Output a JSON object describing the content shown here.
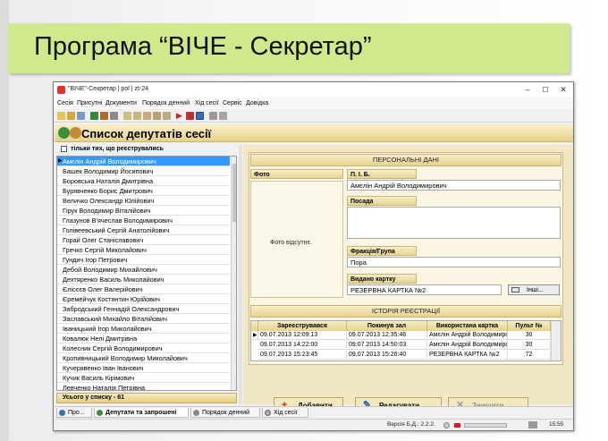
{
  "slide": {
    "title": "Програма “ВІЧЕ - Секретар”"
  },
  "window": {
    "title": "\"ВІЧЕ\"-Секретар | pol | zt-24",
    "controls": {
      "minimize": "–",
      "maximize": "☐",
      "close": "✕"
    }
  },
  "menu": [
    "Сесія",
    "Присутні",
    "Документи",
    "Порядок денний",
    "Хід сесії",
    "Сервіс",
    "Довідка"
  ],
  "header": {
    "title": "Список депутатів сесії"
  },
  "filter": {
    "label": "тільки тих, що реєструвались",
    "checked": false
  },
  "deputies": {
    "items": [
      "Амєлін Андрій Володимирович",
      "Башек Володимир Йосипович",
      "Боровська Наталія Дмитрівна",
      "Бурявченко Борис Дмитрович",
      "Величко Олександр Юлійович",
      "Гірук Володимир Віталійович",
      "Глазунов В'ячеслав Володимирович",
      "Голівеевський Сергій Анатолійович",
      "Горай Олег Станіславович",
      "Гречко Сергій Миколайович",
      "Гундич Ігор Петрович",
      "Дебой Володимир Михайлович",
      "Дехтяренко Василь Миколайович",
      "Єлісєєв Олег Валерійович",
      "Єремейчук Костянтин Юрійович",
      "Забродський Геннадій Олександрович",
      "Заславський Михайло Віталійович",
      "Іваницький Ігор Миколайович",
      "Ковалюк Нелі Дмитрівна",
      "Колесник Сергій Володимирович",
      "Кропивницький Володимир Миколайович",
      "Кучерявенко Іван Іванович",
      "Кучик Василь Кірімович",
      "Левченко Наталія Петрівна"
    ],
    "selected_index": 0
  },
  "total": {
    "label": "Усього у списку - 61"
  },
  "details": {
    "section_title": "ПЕРСОНАЛЬНІ ДАНІ",
    "photo_label": "Фото",
    "photo_placeholder": "Фото відсутнє.",
    "name_label": "П. І. Б.",
    "name_value": "Амєлін Андрій Володимирович",
    "position_label": "Посада",
    "position_value": "",
    "faction_label": "Фракція/Група",
    "faction_value": "Пора",
    "card_label": "Видано картку",
    "card_value": "РЕЗЕРВНА КАРТКА №2",
    "other_button": "Інші..."
  },
  "history": {
    "title": "ІСТОРІЯ РЕЄСТРАЦІЇ",
    "columns": [
      "Зареєструвався",
      "Покинув зал",
      "Використана картка",
      "Пульт №"
    ],
    "rows": [
      [
        "09.07.2013 12:09:13",
        "09.07.2013 12:35:46",
        "Амєлін Андрій Володимирович",
        "30"
      ],
      [
        "09.07.2013 14:22:00",
        "09.07.2013 14:50:03",
        "Амєлін Андрій Володимирович",
        "30"
      ],
      [
        "09.07.2013 15:23:45",
        "09.07.2013 15:26:40",
        "РЕЗЕРВНА КАРТКА №2",
        "72"
      ]
    ]
  },
  "actions": {
    "add": "Добавити",
    "edit": "Редагувати",
    "delete": "Знищити"
  },
  "tabs": [
    "Про...",
    "Депутати та запрошені",
    "Порядок денний",
    "Хід сесії"
  ],
  "status": {
    "db_version": "Версія Б.Д.: 2.2.2",
    "time": "15:55"
  }
}
